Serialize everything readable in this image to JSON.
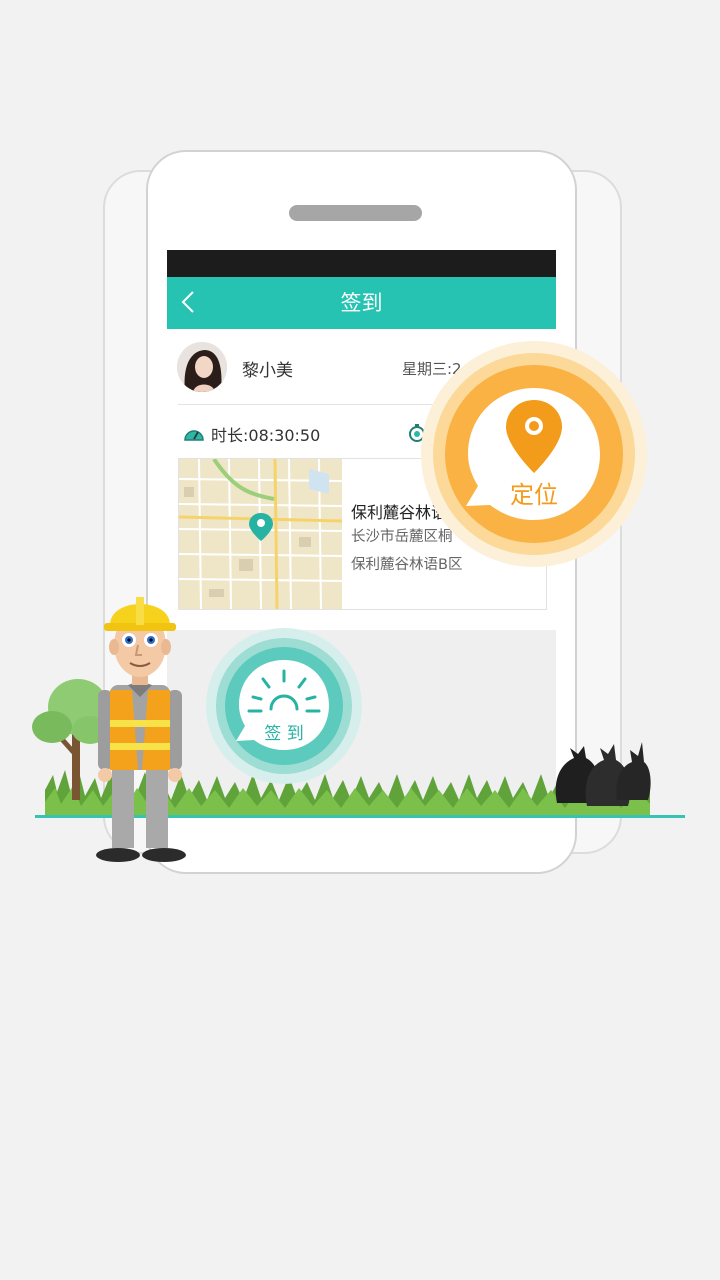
{
  "header": {
    "title": "签到",
    "back_label": "<"
  },
  "profile": {
    "name": "黎小美",
    "weekday": "星期三:2"
  },
  "stats": {
    "duration": "时长:08:30:50"
  },
  "location_card": {
    "place_name": "保利麓谷林语",
    "address": "长沙市岳麓区桐",
    "sub_address": "保利麓谷林语B区"
  },
  "badges": {
    "locate_label": "定位",
    "signin_label": "签 到"
  },
  "colors": {
    "primary": "#27c3b2",
    "accent": "#f39b1b",
    "background": "#f2f2f2"
  }
}
